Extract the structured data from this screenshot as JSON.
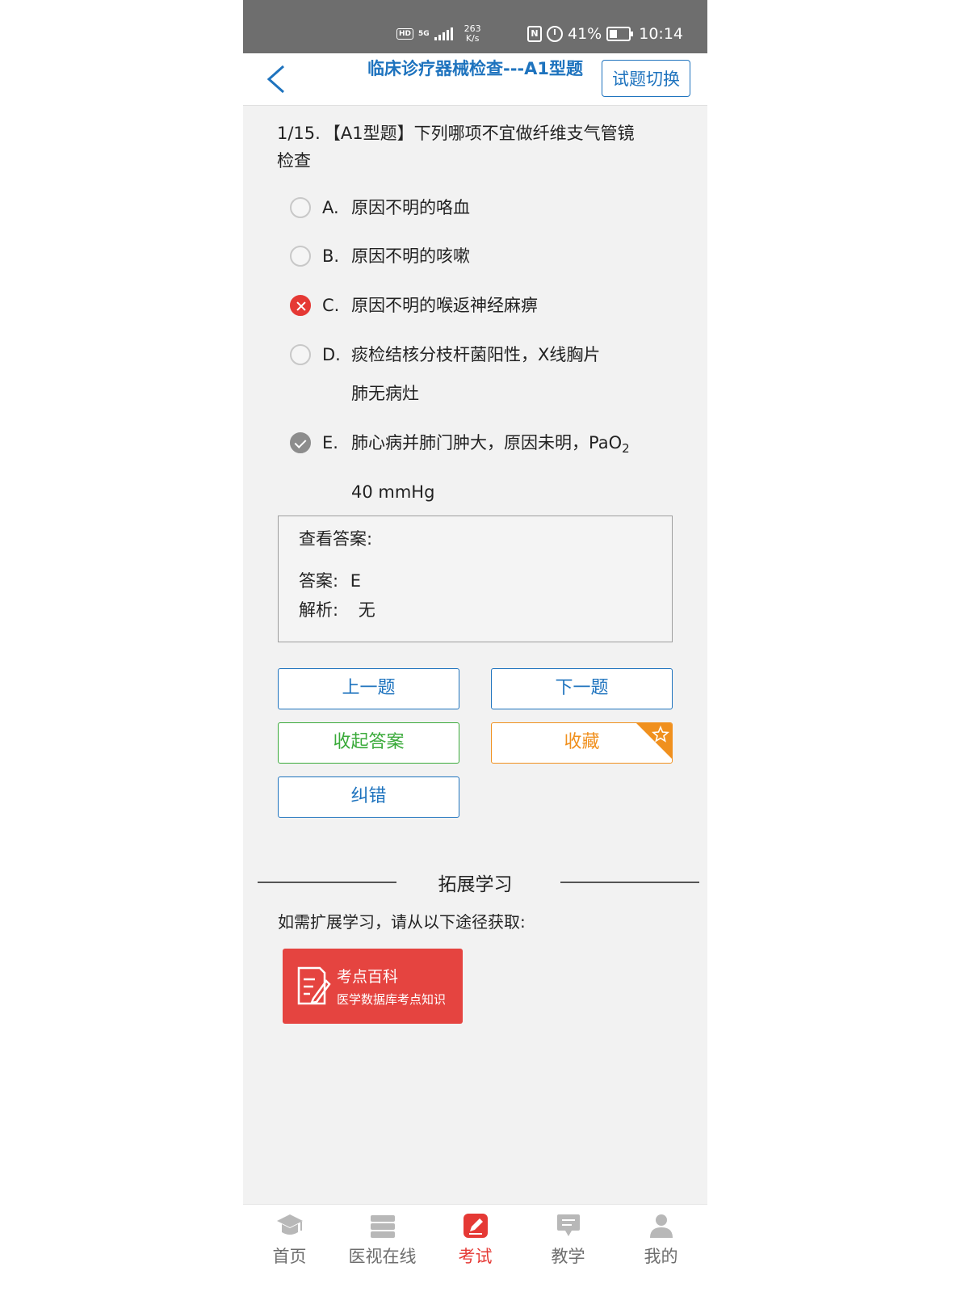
{
  "status_bar": {
    "hd": "HD",
    "net": "5G",
    "speed_value": "263",
    "speed_unit": "K/s",
    "nfc": "N",
    "battery": "41%",
    "time": "10:14"
  },
  "header": {
    "title": "临床诊疗器械检查---A1型题",
    "switch_label": "试题切换"
  },
  "question": {
    "number": "1/15.",
    "text": "【A1型题】下列哪项不宜做纤维支气管镜检查",
    "options": [
      {
        "letter": "A.",
        "text": "原因不明的咯血",
        "state": "none"
      },
      {
        "letter": "B.",
        "text": "原因不明的咳嗽",
        "state": "none"
      },
      {
        "letter": "C.",
        "text": "原因不明的喉返神经麻痹",
        "state": "wrong"
      },
      {
        "letter": "D.",
        "text": "痰检结核分枝杆菌阳性，X线胸片肺无病灶",
        "state": "none"
      },
      {
        "letter": "E.",
        "text_main": "肺心病并肺门肿大，原因未明，PaO",
        "text_sub": "2",
        "text_tail": "40 mmHg",
        "state": "correct"
      }
    ]
  },
  "answer_box": {
    "title": "查看答案:",
    "answer_label": "答案:",
    "answer_value": "E",
    "explain_label": "解析:",
    "explain_value": "无"
  },
  "buttons": {
    "prev": "上一题",
    "next": "下一题",
    "hide_answer": "收起答案",
    "favorite": "收藏",
    "report_error": "纠错"
  },
  "extended": {
    "title": "拓展学习",
    "desc": "如需扩展学习，请从以下途径获取:",
    "card_title": "考点百科",
    "card_subtitle": "医学数据库考点知识"
  },
  "tabbar": {
    "items": [
      {
        "label": "首页",
        "icon": "graduation-cap-icon"
      },
      {
        "label": "医视在线",
        "icon": "stack-icon"
      },
      {
        "label": "考试",
        "icon": "exam-pen-icon"
      },
      {
        "label": "教学",
        "icon": "teaching-board-icon"
      },
      {
        "label": "我的",
        "icon": "user-icon"
      }
    ],
    "active_index": 2
  },
  "colors": {
    "primary_blue": "#1e73be",
    "green": "#3aaa3a",
    "orange": "#f0901e",
    "red": "#e53935",
    "card_red": "#e54440"
  }
}
